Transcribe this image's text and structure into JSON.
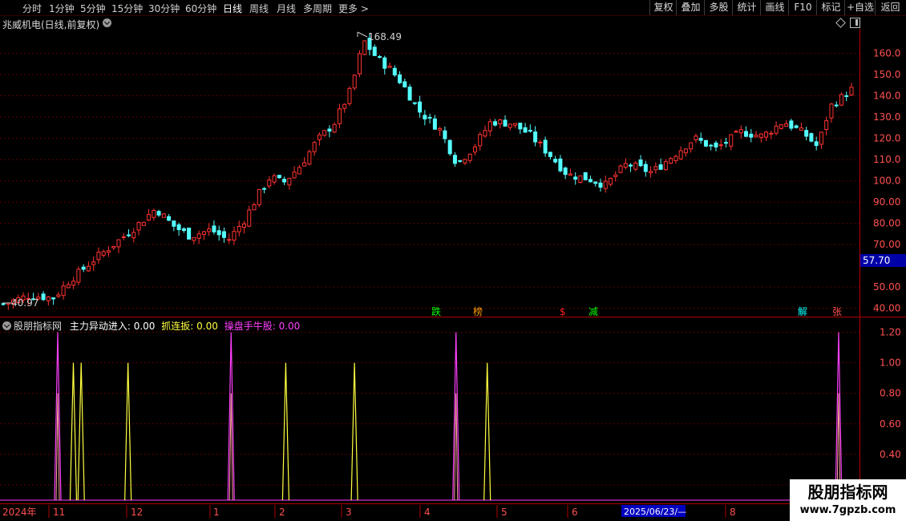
{
  "toolbar": {
    "tabs": [
      "分时",
      "1分钟",
      "5分钟",
      "15分钟",
      "30分钟",
      "60分钟",
      "日线",
      "周线",
      "月线",
      "多周期",
      "更多 >"
    ],
    "active_tab": "日线",
    "buttons": [
      "复权",
      "叠加",
      "多股",
      "统计",
      "画线",
      "F10",
      "标记",
      "+自选",
      "返回"
    ]
  },
  "stock_title": "兆威机电(日线,前复权)",
  "price_chart": {
    "y_ticks": [
      "160.0",
      "150.0",
      "140.0",
      "130.0",
      "120.0",
      "110.0",
      "100.0",
      "90.00",
      "80.00",
      "70.00",
      "50.00",
      "40.00"
    ],
    "current_price_label": "57.70",
    "high_label": "168.49",
    "low_label": "40.97",
    "signal_markers": [
      {
        "text": "跌",
        "color": "#00ff00"
      },
      {
        "text": "榜",
        "color": "#ff9900"
      },
      {
        "text": "$",
        "color": "#ff2020"
      },
      {
        "text": "减",
        "color": "#00ff00"
      },
      {
        "text": "解",
        "color": "#00ffff"
      },
      {
        "text": "张",
        "color": "#ff5050"
      }
    ]
  },
  "indicator": {
    "name": "股朋指标网",
    "line1_label": "主力异动进入:",
    "line1_value": "0.00",
    "line2_label": "抓连扳:",
    "line2_value": "0.00",
    "line3_label": "操盘手牛股:",
    "line3_value": "0.00",
    "y_ticks": [
      "1.20",
      "1.00",
      "0.80",
      "0.60",
      "0.40",
      "0.20"
    ],
    "colors": {
      "line1": "#ffffff",
      "line2": "#ffff40",
      "line3": "#ff40ff"
    }
  },
  "date_axis": {
    "labels": [
      "2024年",
      "11",
      "12",
      "1",
      "2",
      "3",
      "4",
      "5",
      "6",
      "7",
      "8"
    ],
    "cursor_label": "2025/06/23/—"
  },
  "watermark": {
    "name": "股朋指标网",
    "url": "www.7gpzb.com"
  },
  "chart_data": {
    "type": "candlestick",
    "title": "兆威机电(日线,前复权)",
    "y_range": [
      38,
      170
    ],
    "annotated_high": 168.49,
    "annotated_low": 40.97,
    "last_price_marker": 57.7,
    "up_color": "#ff3232",
    "down_color": "#54ffff",
    "close_path": [
      {
        "t": 0.0,
        "p": 42
      },
      {
        "t": 0.03,
        "p": 46
      },
      {
        "t": 0.06,
        "p": 45
      },
      {
        "t": 0.075,
        "p": 52
      },
      {
        "t": 0.09,
        "p": 57
      },
      {
        "t": 0.11,
        "p": 64
      },
      {
        "t": 0.13,
        "p": 70
      },
      {
        "t": 0.155,
        "p": 78
      },
      {
        "t": 0.18,
        "p": 87
      },
      {
        "t": 0.2,
        "p": 79
      },
      {
        "t": 0.22,
        "p": 74
      },
      {
        "t": 0.245,
        "p": 77
      },
      {
        "t": 0.265,
        "p": 72
      },
      {
        "t": 0.285,
        "p": 82
      },
      {
        "t": 0.3,
        "p": 93
      },
      {
        "t": 0.315,
        "p": 102
      },
      {
        "t": 0.33,
        "p": 99
      },
      {
        "t": 0.35,
        "p": 107
      },
      {
        "t": 0.37,
        "p": 119
      },
      {
        "t": 0.39,
        "p": 127
      },
      {
        "t": 0.41,
        "p": 143
      },
      {
        "t": 0.425,
        "p": 166
      },
      {
        "t": 0.44,
        "p": 158
      },
      {
        "t": 0.455,
        "p": 153
      },
      {
        "t": 0.47,
        "p": 146
      },
      {
        "t": 0.49,
        "p": 133
      },
      {
        "t": 0.515,
        "p": 124
      },
      {
        "t": 0.535,
        "p": 108
      },
      {
        "t": 0.555,
        "p": 116
      },
      {
        "t": 0.575,
        "p": 128
      },
      {
        "t": 0.6,
        "p": 127
      },
      {
        "t": 0.62,
        "p": 122
      },
      {
        "t": 0.645,
        "p": 112
      },
      {
        "t": 0.665,
        "p": 103
      },
      {
        "t": 0.69,
        "p": 101
      },
      {
        "t": 0.71,
        "p": 98
      },
      {
        "t": 0.735,
        "p": 108
      },
      {
        "t": 0.765,
        "p": 104
      },
      {
        "t": 0.79,
        "p": 112
      },
      {
        "t": 0.815,
        "p": 120
      },
      {
        "t": 0.84,
        "p": 115
      },
      {
        "t": 0.87,
        "p": 123
      },
      {
        "t": 0.895,
        "p": 121
      },
      {
        "t": 0.92,
        "p": 128
      },
      {
        "t": 0.945,
        "p": 122
      },
      {
        "t": 0.96,
        "p": 116
      },
      {
        "t": 0.975,
        "p": 135
      },
      {
        "t": 1.0,
        "p": 143
      }
    ],
    "indicator_spikes": [
      {
        "t": 0.0,
        "value": 1.2,
        "series": "操盘手牛股"
      },
      {
        "t": 0.02,
        "value": 1.0,
        "series": "抓连扳"
      },
      {
        "t": 0.03,
        "value": 1.0,
        "series": "抓连扳"
      },
      {
        "t": 0.09,
        "value": 1.0,
        "series": "抓连扳"
      },
      {
        "t": 0.222,
        "value": 1.2,
        "series": "操盘手牛股"
      },
      {
        "t": 0.292,
        "value": 1.0,
        "series": "抓连扳"
      },
      {
        "t": 0.38,
        "value": 1.0,
        "series": "抓连扳"
      },
      {
        "t": 0.51,
        "value": 1.2,
        "series": "操盘手牛股"
      },
      {
        "t": 0.55,
        "value": 1.0,
        "series": "抓连扳"
      },
      {
        "t": 1.0,
        "value": 1.2,
        "series": "操盘手牛股"
      }
    ],
    "indicator_y_range": [
      0.1,
      1.25
    ]
  }
}
